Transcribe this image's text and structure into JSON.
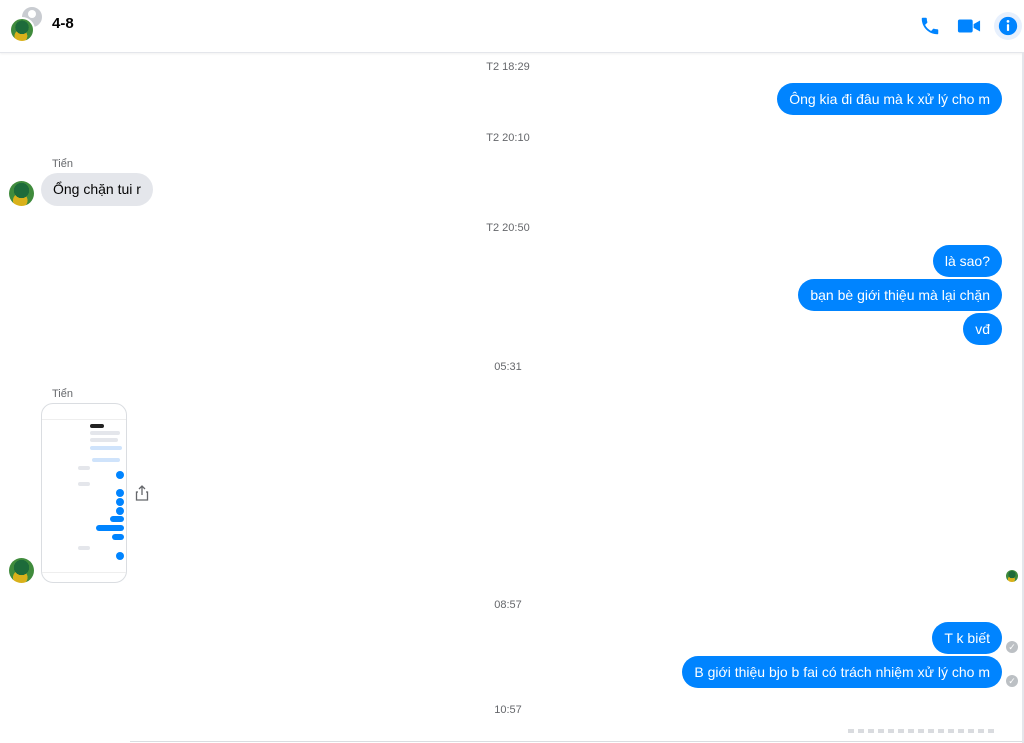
{
  "header": {
    "title": "4-8",
    "call_icon": "phone-icon",
    "video_icon": "video-camera-icon",
    "info_icon": "info-icon",
    "accent_color": "#0084ff"
  },
  "timestamps": [
    "T2 18:29",
    "T2 20:10",
    "T2 20:50",
    "05:31",
    "08:57",
    "10:57"
  ],
  "messages": {
    "m1": "Ông kia đi đâu mà k xử lý cho m",
    "m2_sender": "Tiển",
    "m2": "Ổng chặn tui r",
    "m3": "là sao?",
    "m4": "bạn bè giới thiệu mà lại chặn",
    "m5": "vđ",
    "m6_sender": "Tiển",
    "m7": "T k biết",
    "m8": "B giới thiệu bjo b fai có trách nhiệm xử lý cho m"
  },
  "attachments": {
    "photo_icon": "screenshot-image",
    "share_icon": "share-icon"
  },
  "colors": {
    "outgoing_bubble": "#0084ff",
    "incoming_bubble": "#e4e6eb",
    "timestamp_text": "#65676b"
  }
}
